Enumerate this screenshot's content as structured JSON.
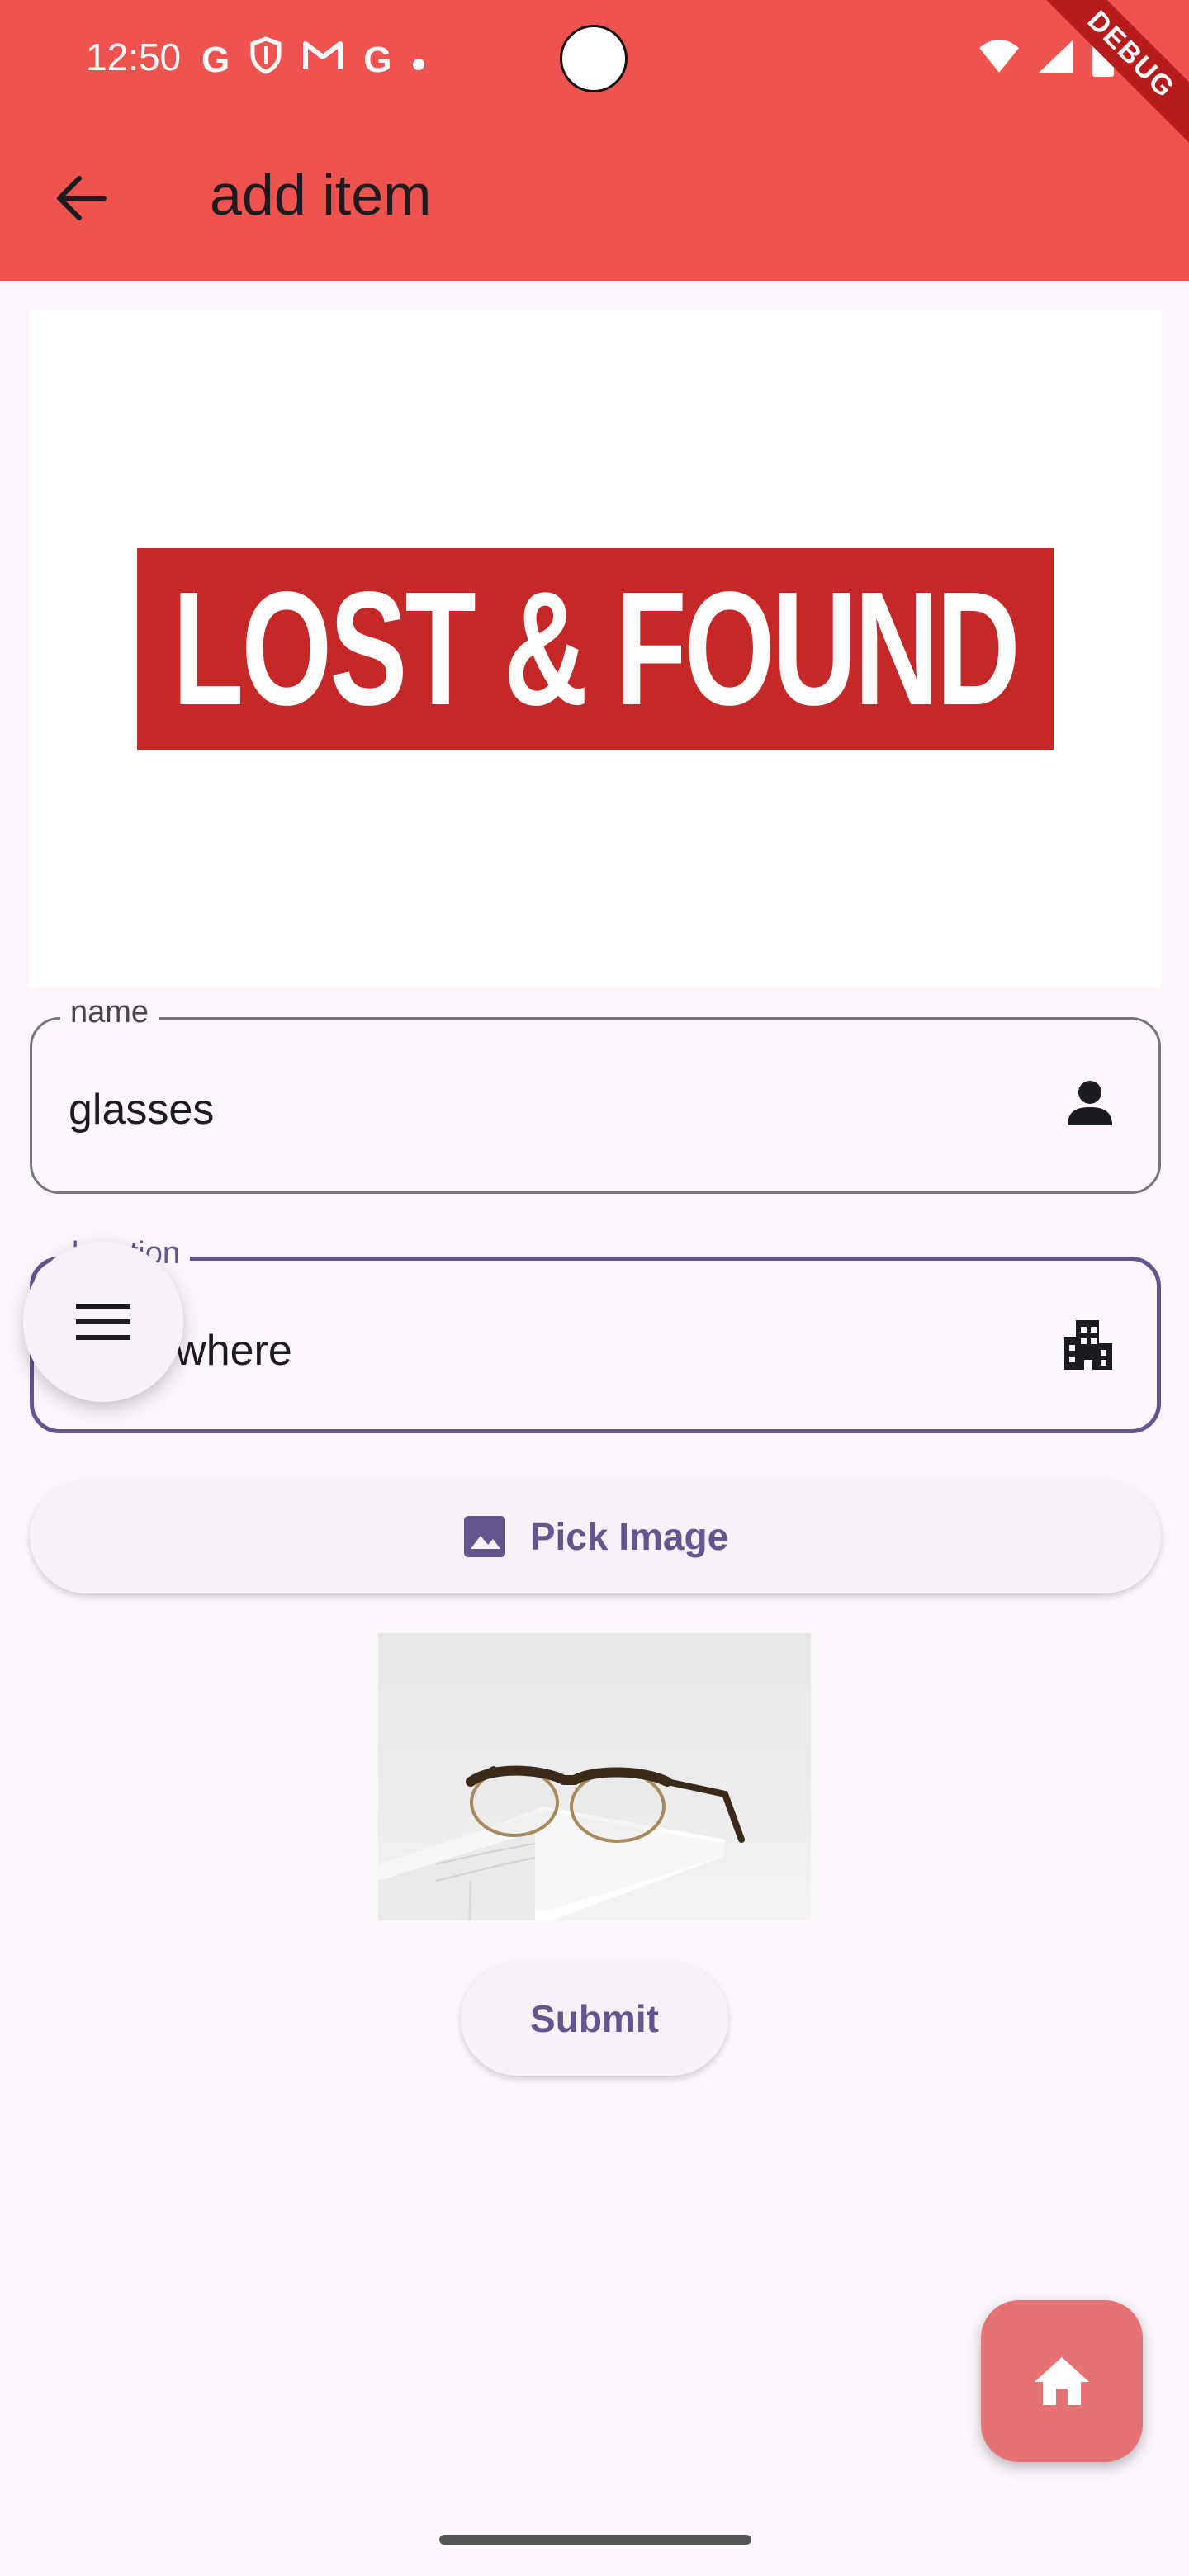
{
  "status_bar": {
    "time": "12:50",
    "left_icons": [
      "google-g-icon",
      "shield-icon",
      "gmail-icon",
      "google-g-icon",
      "dot-icon"
    ],
    "right_icons": [
      "wifi-icon",
      "signal-icon",
      "battery-icon"
    ]
  },
  "debug_banner": "DEBUG",
  "app_bar": {
    "title": "add item",
    "back_icon": "arrow-back-icon",
    "color": "#ef5350"
  },
  "banner": {
    "logo_text": "LOST & FOUND",
    "logo_color": "#c62828"
  },
  "form": {
    "name": {
      "label": "name",
      "value": "glasses",
      "icon": "person-icon"
    },
    "location": {
      "label": "location",
      "value": "somewhere",
      "icon": "apartment-icon",
      "focused": true
    },
    "pick_image": {
      "label": "Pick Image",
      "icon": "image-icon"
    },
    "submit": {
      "label": "Submit"
    }
  },
  "menu_fab": {
    "icon": "menu-icon"
  },
  "home_fab": {
    "icon": "home-icon"
  },
  "colors": {
    "accent": "#65558f",
    "background": "#fdf7fd",
    "home_fab": "#e57373"
  }
}
